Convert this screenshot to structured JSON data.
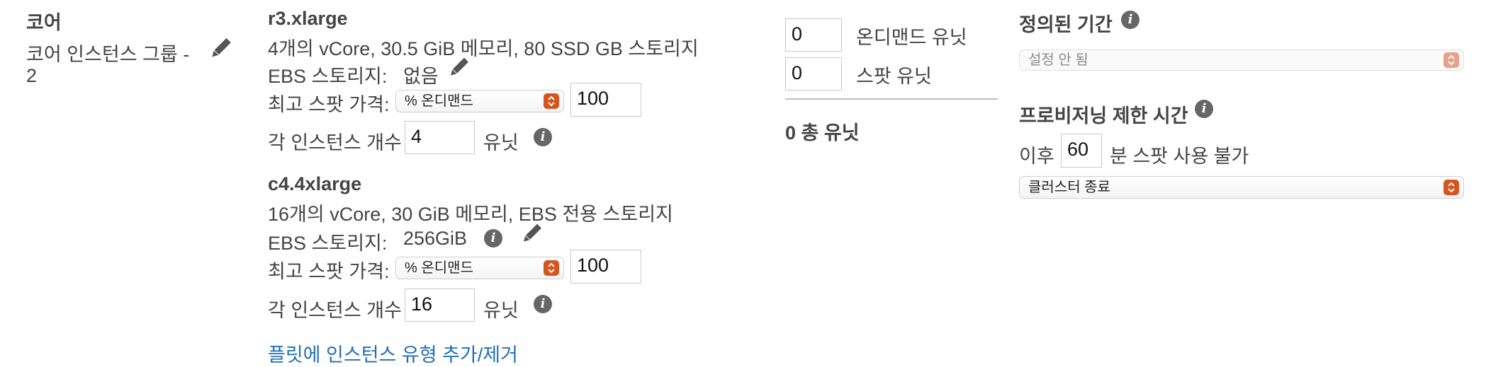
{
  "core": {
    "heading": "코어",
    "group_line1": "코어 인스턴스 그룹 -",
    "group_line2": "2"
  },
  "instances": [
    {
      "type": "r3.xlarge",
      "spec": "4개의 vCore, 30.5 GiB 메모리, 80 SSD GB 스토리지",
      "ebs_label": "EBS 스토리지:",
      "ebs_value": "없음",
      "max_spot_label": "최고 스팟 가격:",
      "max_spot_option": "% 온디맨드",
      "max_spot_value": "100",
      "per_instance_label": "각 인스턴스 개수",
      "per_instance_value": "4",
      "unit_label": "유닛"
    },
    {
      "type": "c4.4xlarge",
      "spec": "16개의 vCore, 30 GiB 메모리, EBS 전용 스토리지",
      "ebs_label": "EBS 스토리지:",
      "ebs_value": "256GiB",
      "max_spot_label": "최고 스팟 가격:",
      "max_spot_option": "% 온디맨드",
      "max_spot_value": "100",
      "per_instance_label": "각 인스턴스 개수",
      "per_instance_value": "16",
      "unit_label": "유닛"
    }
  ],
  "add_remove_link": "플릿에 인스턴스 유형 추가/제거",
  "units": {
    "on_demand_value": "0",
    "on_demand_label": "온디맨드 유닛",
    "spot_value": "0",
    "spot_label": "스팟 유닛",
    "total": "0 총 유닛"
  },
  "defined_duration": {
    "heading": "정의된 기간",
    "select_value": "설정 안 됨"
  },
  "provisioning_timeout": {
    "heading": "프로비저닝 제한 시간",
    "after_label": "이후",
    "minutes_value": "60",
    "suffix_label": "분 스팟 사용 불가",
    "action_value": "클러스터 종료"
  },
  "colors": {
    "accent": "#d6541f",
    "link": "#1f6fb5"
  }
}
